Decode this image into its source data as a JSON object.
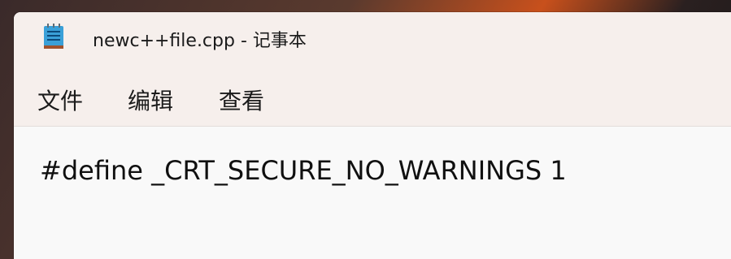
{
  "window": {
    "title": "newc++file.cpp - 记事本",
    "icon": "notepad-icon"
  },
  "menu": {
    "file_label": "文件",
    "edit_label": "编辑",
    "view_label": "查看"
  },
  "editor": {
    "lines": [
      "#define _CRT_SECURE_NO_WARNINGS 1"
    ]
  },
  "colors": {
    "titlebar_bg": "#f6efec",
    "editor_bg": "#f9f9f9",
    "text": "#1b1b1b"
  }
}
